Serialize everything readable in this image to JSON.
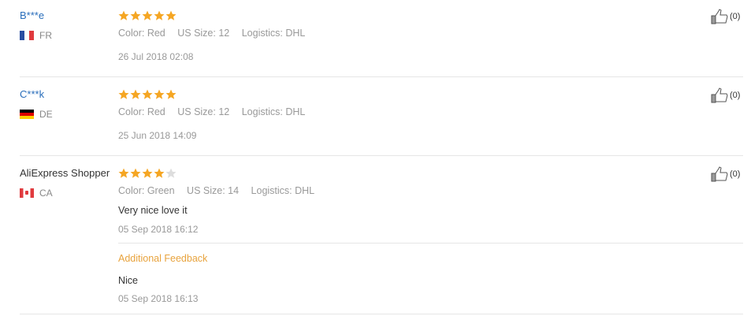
{
  "reviews": [
    {
      "user": "B***e",
      "country": "FR",
      "rating": 5,
      "color": "Color: Red",
      "size": "US Size: 12",
      "logistics": "Logistics: DHL",
      "date": "26 Jul 2018 02:08",
      "helpful_count": "(0)"
    },
    {
      "user": "C***k",
      "country": "DE",
      "rating": 5,
      "color": "Color: Red",
      "size": "US Size: 12",
      "logistics": "Logistics: DHL",
      "date": "25 Jun 2018 14:09",
      "helpful_count": "(0)"
    },
    {
      "user": "AliExpress Shopper",
      "country": "CA",
      "rating": 4,
      "color": "Color: Green",
      "size": "US Size: 14",
      "logistics": "Logistics: DHL",
      "text": "Very nice love it",
      "date": "05 Sep 2018 16:12",
      "additional_label": "Additional Feedback",
      "additional_text": "Nice",
      "additional_date": "05 Sep 2018 16:13",
      "helpful_count": "(0)"
    }
  ],
  "colors": {
    "star_filled": "#f5a623",
    "star_empty": "#dddddd",
    "link": "#2a6ebb",
    "accent": "#e8a33d"
  }
}
